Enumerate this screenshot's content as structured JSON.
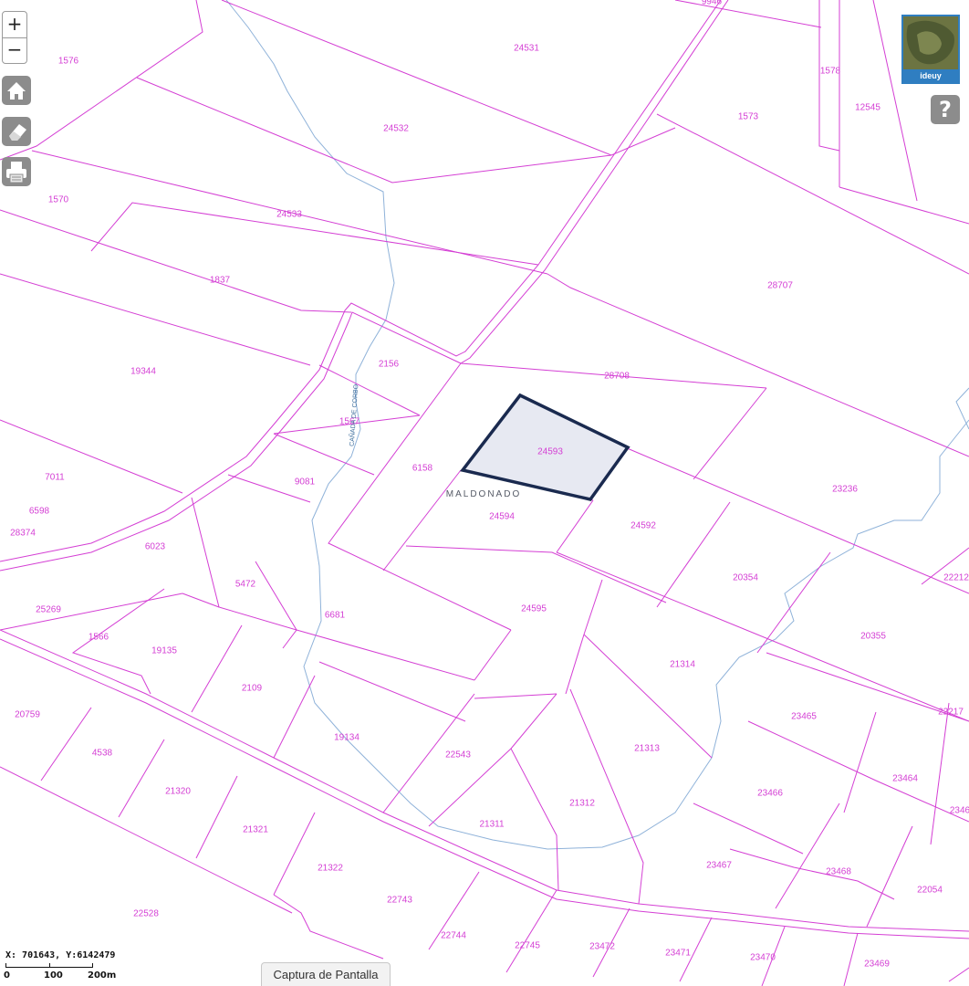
{
  "map": {
    "zone_label": "MALDONADO",
    "stream_label": "CAÑADA DE CORBO",
    "selected_parcel": "24593",
    "colors": {
      "parcel_line": "#d43fd4",
      "stream": "#8fb2d9",
      "selected_fill": "#e7e9f2",
      "selected_outline": "#1a2a4f"
    },
    "parcels": [
      "1576",
      "24531",
      "9946",
      "1578",
      "12545",
      "1573",
      "24532",
      "1570",
      "24533",
      "1837",
      "28707",
      "19344",
      "2156",
      "28708",
      "1567",
      "24593",
      "6158",
      "9081",
      "7011",
      "6598",
      "28374",
      "24594",
      "24592",
      "23236",
      "6023",
      "5472",
      "20354",
      "22212",
      "25269",
      "6681",
      "24595",
      "20355",
      "1566",
      "19135",
      "21314",
      "2109",
      "22543",
      "23465",
      "22217",
      "20759",
      "19134",
      "21313",
      "4538",
      "23464",
      "21320",
      "23466",
      "21312",
      "2346",
      "21321",
      "21311",
      "21322",
      "23467",
      "23468",
      "22054",
      "22528",
      "22743",
      "22744",
      "22745",
      "23472",
      "23471",
      "23470",
      "23469"
    ]
  },
  "controls": {
    "zoom_in": "+",
    "zoom_out": "−",
    "home_icon": "home-icon",
    "eraser_icon": "eraser-icon",
    "print_icon": "printer-icon",
    "help": "?"
  },
  "basemap": {
    "label": "ideuy"
  },
  "status": {
    "coordinates": "X: 701643, Y:6142479",
    "scale_ticks": [
      "0",
      "100",
      "200m"
    ]
  },
  "screenshot_button": "Captura de Pantalla"
}
